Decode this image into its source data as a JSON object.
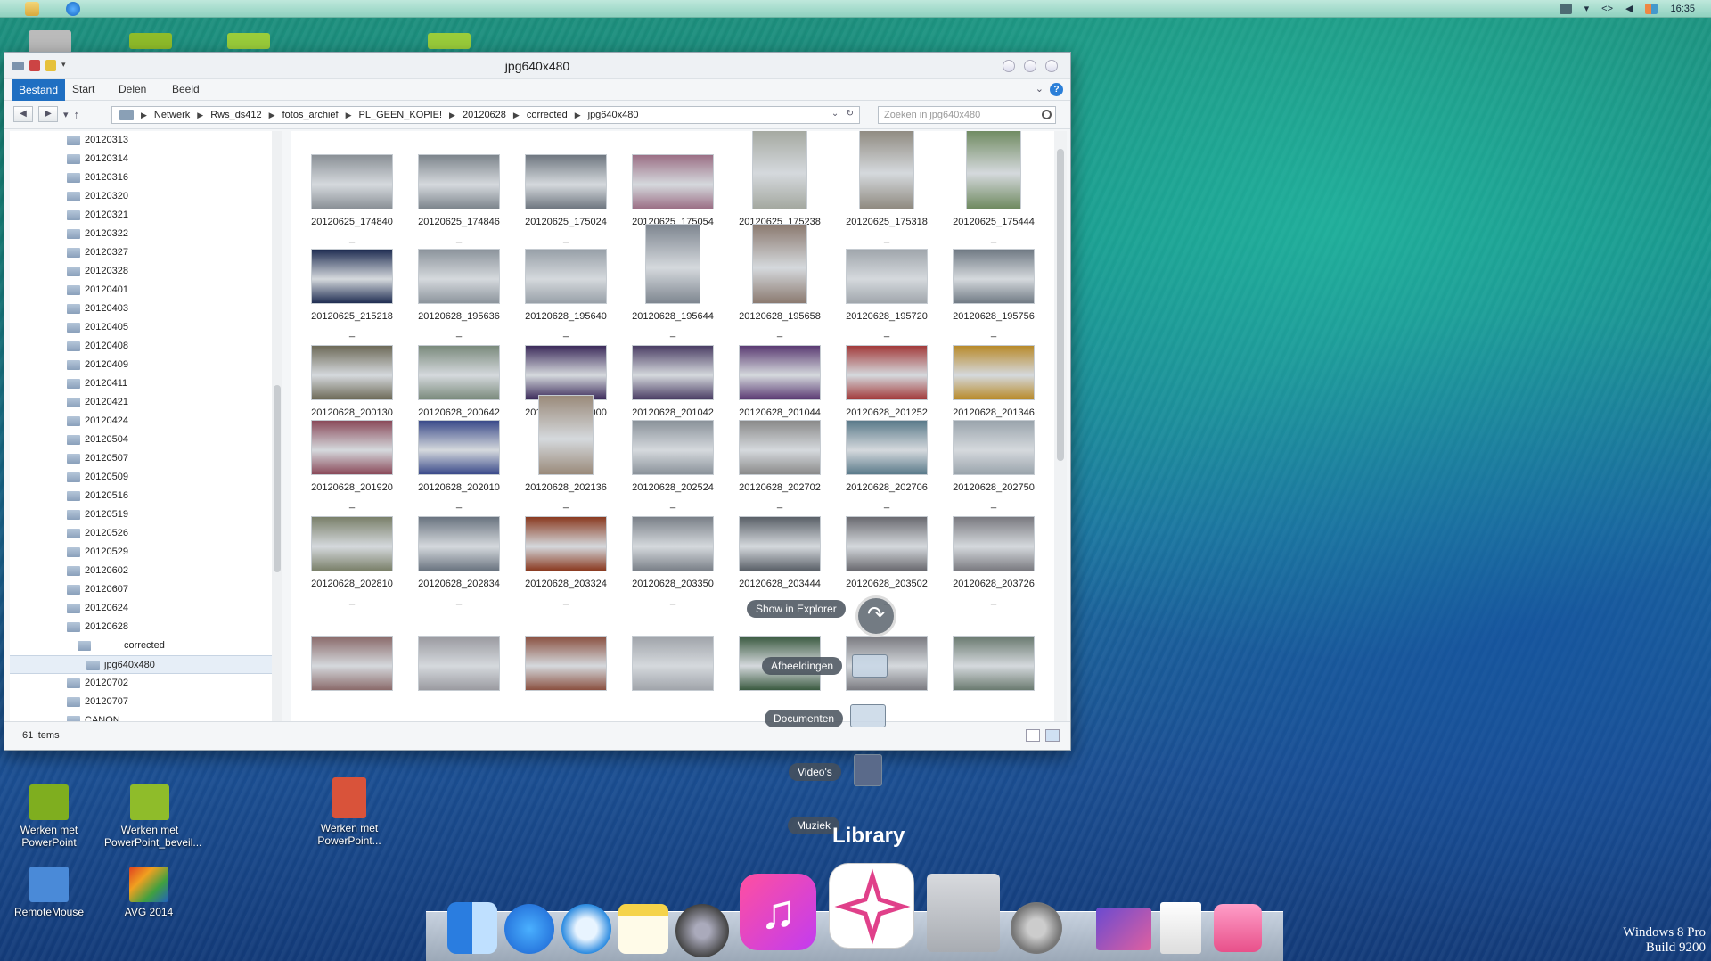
{
  "topbar": {
    "clock": "16:35"
  },
  "window": {
    "title": "jpg640x480",
    "ribbon_tabs": [
      "Bestand",
      "Start",
      "Delen",
      "Beeld"
    ],
    "address": [
      "Netwerk",
      "Rws_ds412",
      "fotos_archief",
      "PL_GEEN_KOPIE!",
      "20120628",
      "corrected",
      "jpg640x480"
    ],
    "search_placeholder": "Zoeken in jpg640x480",
    "tree": [
      "20120313",
      "20120314",
      "20120316",
      "20120320",
      "20120321",
      "20120322",
      "20120327",
      "20120328",
      "20120401",
      "20120403",
      "20120405",
      "20120408",
      "20120409",
      "20120411",
      "20120421",
      "20120424",
      "20120504",
      "20120507",
      "20120509",
      "20120516",
      "20120519",
      "20120526",
      "20120529",
      "20120602",
      "20120607",
      "20120624",
      "20120628"
    ],
    "tree_corrected": "corrected",
    "tree_selected": "jpg640x480",
    "tree_after": [
      "20120702",
      "20120707",
      "CANON"
    ],
    "status_count": "61 items",
    "files": [
      {
        "name": "20120625_174840",
        "suffix": "_",
        "orient": "land",
        "color": "#8a9096"
      },
      {
        "name": "20120625_174846",
        "suffix": "_",
        "orient": "land",
        "color": "#7d858c"
      },
      {
        "name": "20120625_175024",
        "suffix": "_",
        "orient": "land",
        "color": "#6f7780"
      },
      {
        "name": "20120625_175054",
        "suffix": "_",
        "orient": "land",
        "color": "#9b6f85"
      },
      {
        "name": "20120625_175238",
        "suffix": "_",
        "orient": "port",
        "color": "#a4a8a0"
      },
      {
        "name": "20120625_175318",
        "suffix": "_",
        "orient": "port",
        "color": "#8f8a80"
      },
      {
        "name": "20120625_175444",
        "suffix": "_",
        "orient": "port",
        "color": "#6f8a60"
      },
      {
        "name": "20120625_215218",
        "suffix": "_",
        "orient": "land",
        "color": "#1f2d52"
      },
      {
        "name": "20120628_195636",
        "suffix": "_",
        "orient": "land",
        "color": "#8c949c"
      },
      {
        "name": "20120628_195640",
        "suffix": "_",
        "orient": "land",
        "color": "#98a0a8"
      },
      {
        "name": "20120628_195644",
        "suffix": "_",
        "orient": "port",
        "color": "#7e8690"
      },
      {
        "name": "20120628_195658",
        "suffix": "_",
        "orient": "port",
        "color": "#8b7a70"
      },
      {
        "name": "20120628_195720",
        "suffix": "_",
        "orient": "land",
        "color": "#a0a6ac"
      },
      {
        "name": "20120628_195756",
        "suffix": "_",
        "orient": "land",
        "color": "#707a84"
      },
      {
        "name": "20120628_200130",
        "suffix": "_",
        "orient": "land",
        "color": "#6d6a58"
      },
      {
        "name": "20120628_200642",
        "suffix": "_",
        "orient": "land",
        "color": "#7a8a7c"
      },
      {
        "name": "20120628_201000",
        "suffix": "_",
        "orient": "land",
        "color": "#3b2a5a"
      },
      {
        "name": "20120628_201042",
        "suffix": "_",
        "orient": "land",
        "color": "#4a3d64"
      },
      {
        "name": "20120628_201044",
        "suffix": "_",
        "orient": "land",
        "color": "#5a3a72"
      },
      {
        "name": "20120628_201252",
        "suffix": "_",
        "orient": "land",
        "color": "#a23a3a"
      },
      {
        "name": "20120628_201346",
        "suffix": "_",
        "orient": "land",
        "color": "#b88a2a"
      },
      {
        "name": "20120628_201920",
        "suffix": "_",
        "orient": "land",
        "color": "#8a4a5a"
      },
      {
        "name": "20120628_202010",
        "suffix": "_",
        "orient": "land",
        "color": "#3a4a8a"
      },
      {
        "name": "20120628_202136",
        "suffix": "_",
        "orient": "port",
        "color": "#9a8a7a"
      },
      {
        "name": "20120628_202524",
        "suffix": "_",
        "orient": "land",
        "color": "#8a929a"
      },
      {
        "name": "20120628_202702",
        "suffix": "_",
        "orient": "land",
        "color": "#8a8a8a"
      },
      {
        "name": "20120628_202706",
        "suffix": "_",
        "orient": "land",
        "color": "#5a7a8a"
      },
      {
        "name": "20120628_202750",
        "suffix": "_",
        "orient": "land",
        "color": "#9aa4ac"
      },
      {
        "name": "20120628_202810",
        "suffix": "_",
        "orient": "land",
        "color": "#7a806a"
      },
      {
        "name": "20120628_202834",
        "suffix": "_",
        "orient": "land",
        "color": "#6a7480"
      },
      {
        "name": "20120628_203324",
        "suffix": "_",
        "orient": "land",
        "color": "#8a3a20"
      },
      {
        "name": "20120628_203350",
        "suffix": "_",
        "orient": "land",
        "color": "#7a8088"
      },
      {
        "name": "20120628_203444",
        "suffix": "_",
        "orient": "land",
        "color": "#5a6068"
      },
      {
        "name": "20120628_203502",
        "suffix": "_",
        "orient": "land",
        "color": "#6a6a70"
      },
      {
        "name": "20120628_203726",
        "suffix": "_",
        "orient": "land",
        "color": "#7a7a80"
      },
      {
        "name": "",
        "suffix": "",
        "orient": "land",
        "color": "#8a6a6a"
      },
      {
        "name": "",
        "suffix": "",
        "orient": "land",
        "color": "#9a9aa0"
      },
      {
        "name": "",
        "suffix": "",
        "orient": "land",
        "color": "#8a5040"
      },
      {
        "name": "",
        "suffix": "",
        "orient": "land",
        "color": "#a0a4aa"
      },
      {
        "name": "",
        "suffix": "",
        "orient": "land",
        "color": "#3a5a40"
      },
      {
        "name": "",
        "suffix": "",
        "orient": "land",
        "color": "#7a7a80"
      },
      {
        "name": "",
        "suffix": "",
        "orient": "land",
        "color": "#6a7a70"
      }
    ]
  },
  "overlays": {
    "show_in_explorer": "Show in Explorer",
    "libraries": [
      "Afbeeldingen",
      "Documenten",
      "Video's",
      "Muziek"
    ],
    "library_title": "Library"
  },
  "desktop_icons": [
    {
      "label": "Werken met PowerPoint",
      "color": "#7fae1f"
    },
    {
      "label": "Werken met PowerPoint_beveil...",
      "color": "#8fbc2a"
    },
    {
      "label": "Werken met PowerPoint...",
      "color": "#d9533a"
    },
    {
      "label": "RemoteMouse",
      "color": "#4a8ad8"
    },
    {
      "label": "AVG 2014",
      "color": "#e07a20"
    }
  ],
  "dock": {
    "apps": [
      "finder-icon",
      "app-store-icon",
      "safari-icon",
      "notes-icon",
      "launchpad-icon",
      "itunes-icon",
      "app-launcher-icon",
      "mac-pro-icon",
      "system-preferences-icon",
      "photo-icon",
      "documents-icon",
      "trash-icon"
    ]
  },
  "os_info": {
    "line1": "Windows 8 Pro",
    "line2": "Build 9200"
  },
  "colors": {
    "accent": "#1f6fc2"
  }
}
